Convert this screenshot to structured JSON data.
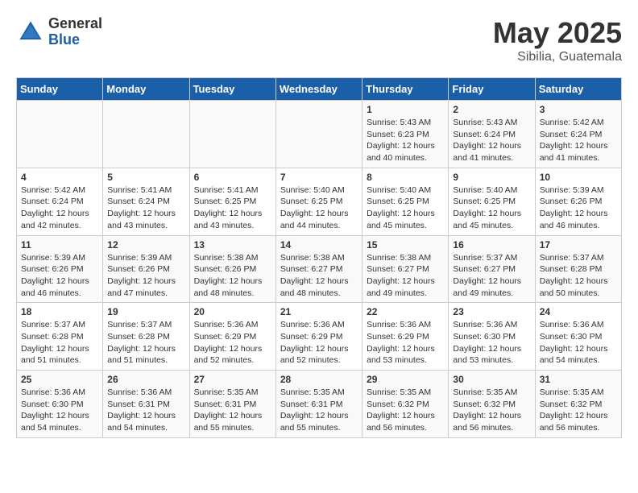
{
  "header": {
    "logo_general": "General",
    "logo_blue": "Blue",
    "month_year": "May 2025",
    "location": "Sibilia, Guatemala"
  },
  "weekdays": [
    "Sunday",
    "Monday",
    "Tuesday",
    "Wednesday",
    "Thursday",
    "Friday",
    "Saturday"
  ],
  "weeks": [
    [
      {
        "day": "",
        "info": ""
      },
      {
        "day": "",
        "info": ""
      },
      {
        "day": "",
        "info": ""
      },
      {
        "day": "",
        "info": ""
      },
      {
        "day": "1",
        "info": "Sunrise: 5:43 AM\nSunset: 6:23 PM\nDaylight: 12 hours\nand 40 minutes."
      },
      {
        "day": "2",
        "info": "Sunrise: 5:43 AM\nSunset: 6:24 PM\nDaylight: 12 hours\nand 41 minutes."
      },
      {
        "day": "3",
        "info": "Sunrise: 5:42 AM\nSunset: 6:24 PM\nDaylight: 12 hours\nand 41 minutes."
      }
    ],
    [
      {
        "day": "4",
        "info": "Sunrise: 5:42 AM\nSunset: 6:24 PM\nDaylight: 12 hours\nand 42 minutes."
      },
      {
        "day": "5",
        "info": "Sunrise: 5:41 AM\nSunset: 6:24 PM\nDaylight: 12 hours\nand 43 minutes."
      },
      {
        "day": "6",
        "info": "Sunrise: 5:41 AM\nSunset: 6:25 PM\nDaylight: 12 hours\nand 43 minutes."
      },
      {
        "day": "7",
        "info": "Sunrise: 5:40 AM\nSunset: 6:25 PM\nDaylight: 12 hours\nand 44 minutes."
      },
      {
        "day": "8",
        "info": "Sunrise: 5:40 AM\nSunset: 6:25 PM\nDaylight: 12 hours\nand 45 minutes."
      },
      {
        "day": "9",
        "info": "Sunrise: 5:40 AM\nSunset: 6:25 PM\nDaylight: 12 hours\nand 45 minutes."
      },
      {
        "day": "10",
        "info": "Sunrise: 5:39 AM\nSunset: 6:26 PM\nDaylight: 12 hours\nand 46 minutes."
      }
    ],
    [
      {
        "day": "11",
        "info": "Sunrise: 5:39 AM\nSunset: 6:26 PM\nDaylight: 12 hours\nand 46 minutes."
      },
      {
        "day": "12",
        "info": "Sunrise: 5:39 AM\nSunset: 6:26 PM\nDaylight: 12 hours\nand 47 minutes."
      },
      {
        "day": "13",
        "info": "Sunrise: 5:38 AM\nSunset: 6:26 PM\nDaylight: 12 hours\nand 48 minutes."
      },
      {
        "day": "14",
        "info": "Sunrise: 5:38 AM\nSunset: 6:27 PM\nDaylight: 12 hours\nand 48 minutes."
      },
      {
        "day": "15",
        "info": "Sunrise: 5:38 AM\nSunset: 6:27 PM\nDaylight: 12 hours\nand 49 minutes."
      },
      {
        "day": "16",
        "info": "Sunrise: 5:37 AM\nSunset: 6:27 PM\nDaylight: 12 hours\nand 49 minutes."
      },
      {
        "day": "17",
        "info": "Sunrise: 5:37 AM\nSunset: 6:28 PM\nDaylight: 12 hours\nand 50 minutes."
      }
    ],
    [
      {
        "day": "18",
        "info": "Sunrise: 5:37 AM\nSunset: 6:28 PM\nDaylight: 12 hours\nand 51 minutes."
      },
      {
        "day": "19",
        "info": "Sunrise: 5:37 AM\nSunset: 6:28 PM\nDaylight: 12 hours\nand 51 minutes."
      },
      {
        "day": "20",
        "info": "Sunrise: 5:36 AM\nSunset: 6:29 PM\nDaylight: 12 hours\nand 52 minutes."
      },
      {
        "day": "21",
        "info": "Sunrise: 5:36 AM\nSunset: 6:29 PM\nDaylight: 12 hours\nand 52 minutes."
      },
      {
        "day": "22",
        "info": "Sunrise: 5:36 AM\nSunset: 6:29 PM\nDaylight: 12 hours\nand 53 minutes."
      },
      {
        "day": "23",
        "info": "Sunrise: 5:36 AM\nSunset: 6:30 PM\nDaylight: 12 hours\nand 53 minutes."
      },
      {
        "day": "24",
        "info": "Sunrise: 5:36 AM\nSunset: 6:30 PM\nDaylight: 12 hours\nand 54 minutes."
      }
    ],
    [
      {
        "day": "25",
        "info": "Sunrise: 5:36 AM\nSunset: 6:30 PM\nDaylight: 12 hours\nand 54 minutes."
      },
      {
        "day": "26",
        "info": "Sunrise: 5:36 AM\nSunset: 6:31 PM\nDaylight: 12 hours\nand 54 minutes."
      },
      {
        "day": "27",
        "info": "Sunrise: 5:35 AM\nSunset: 6:31 PM\nDaylight: 12 hours\nand 55 minutes."
      },
      {
        "day": "28",
        "info": "Sunrise: 5:35 AM\nSunset: 6:31 PM\nDaylight: 12 hours\nand 55 minutes."
      },
      {
        "day": "29",
        "info": "Sunrise: 5:35 AM\nSunset: 6:32 PM\nDaylight: 12 hours\nand 56 minutes."
      },
      {
        "day": "30",
        "info": "Sunrise: 5:35 AM\nSunset: 6:32 PM\nDaylight: 12 hours\nand 56 minutes."
      },
      {
        "day": "31",
        "info": "Sunrise: 5:35 AM\nSunset: 6:32 PM\nDaylight: 12 hours\nand 56 minutes."
      }
    ]
  ]
}
